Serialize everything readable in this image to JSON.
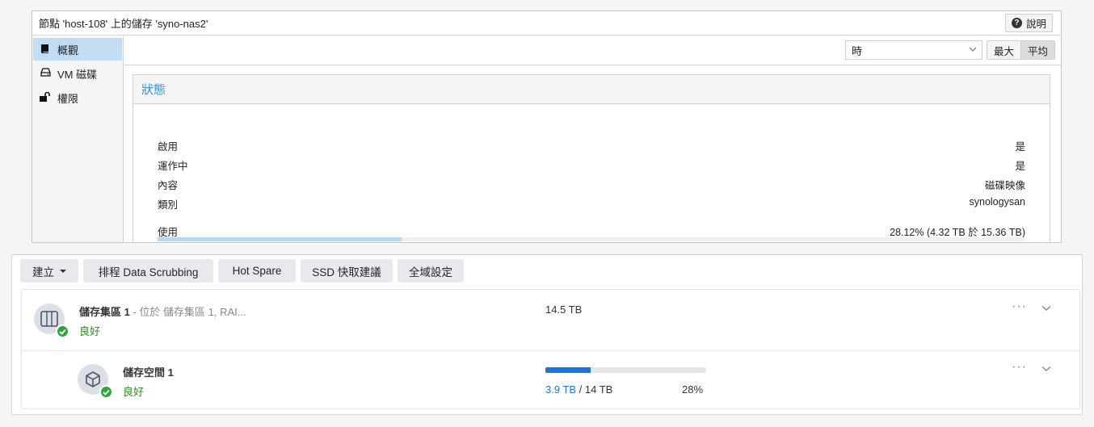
{
  "pve": {
    "title": "節點 'host-108' 上的儲存 'syno-nas2'",
    "help_label": "說明",
    "nav": [
      {
        "label": "概觀",
        "icon": "book-icon"
      },
      {
        "label": "VM 磁碟",
        "icon": "hdd-icon"
      },
      {
        "label": "權限",
        "icon": "unlock-icon"
      }
    ],
    "timeframe": "時",
    "agg_options": [
      "最大",
      "平均"
    ],
    "agg_selected": "平均",
    "status_title": "狀態",
    "rows": [
      {
        "key": "啟用",
        "value": "是"
      },
      {
        "key": "運作中",
        "value": "是"
      },
      {
        "key": "內容",
        "value": "磁碟映像"
      },
      {
        "key": "類別",
        "value": "synologysan"
      }
    ],
    "usage": {
      "key": "使用",
      "value": "28.12% (4.32 TB 於 15.36 TB)",
      "fraction": 0.2812
    }
  },
  "syno": {
    "toolbar": {
      "create": "建立",
      "scrub": "排程 Data Scrubbing",
      "hotspare": "Hot Spare",
      "ssd": "SSD 快取建議",
      "global": "全域設定"
    },
    "pool": {
      "title": "儲存集區 1",
      "subtitle": " - 位於 儲存集區 1, RAI...",
      "status": "良好",
      "size": "14.5 TB"
    },
    "volume": {
      "title": "儲存空間 1",
      "status": "良好",
      "used": "3.9 TB",
      "sep": " / ",
      "total": "14 TB",
      "percent": "28%",
      "fraction": 0.28
    },
    "accent": "#1c74d6",
    "ok_color": "#2b8a1d"
  }
}
